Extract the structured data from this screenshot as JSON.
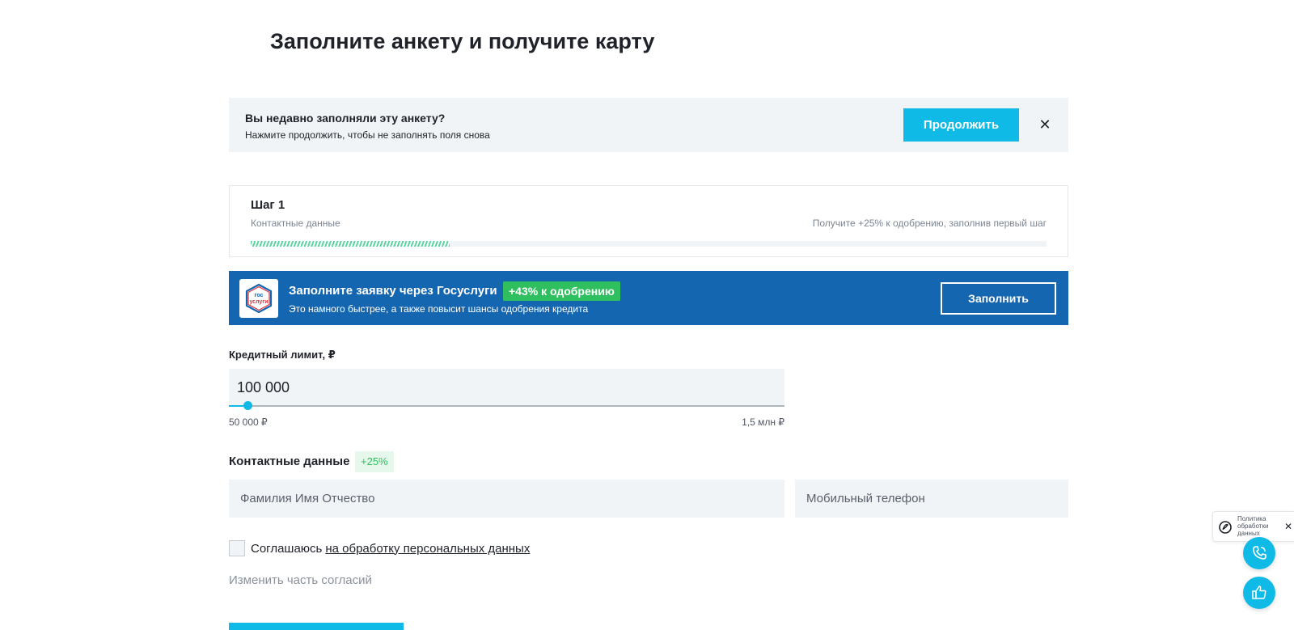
{
  "page": {
    "title": "Заполните анкету и получите карту"
  },
  "resume_banner": {
    "title": "Вы недавно заполняли эту анкету?",
    "subtitle": "Нажмите продолжить, чтобы не заполнять поля снова",
    "button_label": "Продолжить",
    "close_icon": "close-icon",
    "close_glyph": "✕"
  },
  "step": {
    "title": "Шаг 1",
    "subtitle": "Контактные данные",
    "hint": "Получите +25% к одобрению, заполнив первый шаг",
    "progress": 0.25
  },
  "gosuslugi": {
    "logo_text_top": "гос",
    "logo_text_bottom": "услуги",
    "title": "Заполните заявку через Госуслуги",
    "badge": "+43% к одобрению",
    "subtitle": "Это намного быстрее, а также повысит шансы одобрения кредита",
    "button_label": "Заполнить"
  },
  "credit_limit": {
    "label": "Кредитный лимит, ₽",
    "value": "100 000",
    "min_label": "50 000 ₽",
    "max_label": "1,5 млн ₽",
    "slider_fraction": 0.034
  },
  "contacts": {
    "label": "Контактные данные",
    "badge": "+25%",
    "fio_placeholder": "Фамилия Имя Отчество",
    "phone_placeholder": "Мобильный телефон"
  },
  "consent": {
    "text": "Соглашаюсь",
    "link": "на обработку персональных данных",
    "checked": false
  },
  "change_consent": {
    "label": "Изменить часть согласий"
  },
  "policy_widget": {
    "text": "Политика обработки данных",
    "close_glyph": "✕"
  },
  "colors": {
    "accent": "#0fbbe6",
    "gos_blue": "#1466b0",
    "success_green": "#2fbf5f",
    "panel_gray": "#f1f4f7"
  }
}
